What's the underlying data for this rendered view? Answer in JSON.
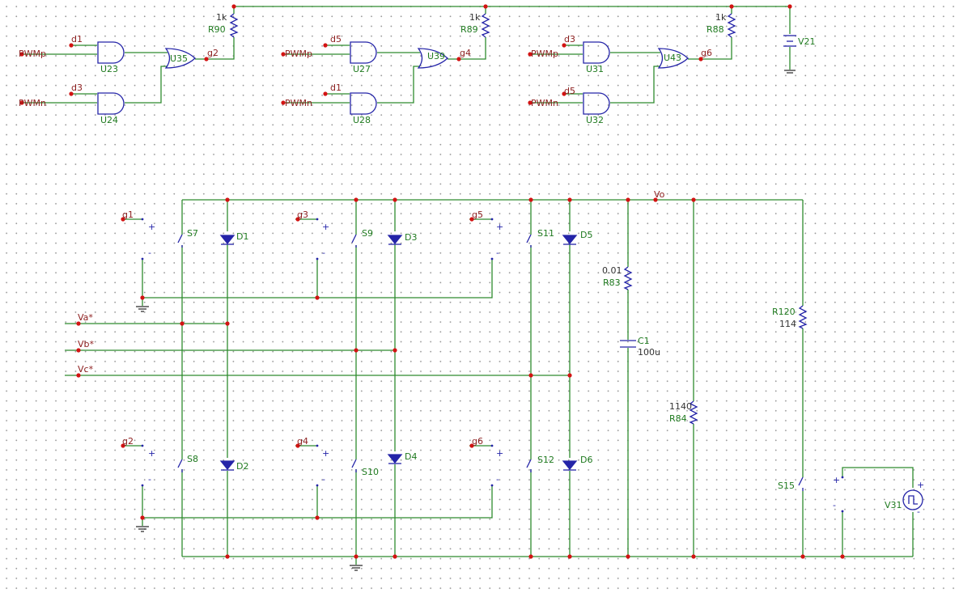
{
  "labels": {
    "pwmp": "PWMp",
    "pwmn": "PWMn",
    "d1": "d1",
    "d3": "d3",
    "d5": "d5",
    "g1": "g1",
    "g2": "g2",
    "g3": "g3",
    "g4": "g4",
    "g5": "g5",
    "g6": "g6",
    "va": "Va*",
    "vb": "Vb*",
    "vc": "Vc*",
    "vo": "Vo"
  },
  "gates": {
    "u23": "U23",
    "u24": "U24",
    "u35": "U35",
    "u27": "U27",
    "u28": "U28",
    "u39": "U39",
    "u31": "U31",
    "u32": "U32",
    "u43": "U43"
  },
  "resistors": {
    "r90": {
      "name": "R90",
      "value": "1k"
    },
    "r89": {
      "name": "R89",
      "value": "1k"
    },
    "r88": {
      "name": "R88",
      "value": "1k"
    },
    "r83": {
      "name": "R83",
      "value": "0.01"
    },
    "r84": {
      "name": "R84",
      "value": "1140"
    },
    "r120": {
      "name": "R120",
      "value": "114"
    }
  },
  "capacitor": {
    "name": "C1",
    "value": "100u"
  },
  "sources": {
    "v21": "V21",
    "v31": "V31"
  },
  "switches": {
    "s7": "S7",
    "s8": "S8",
    "s9": "S9",
    "s10": "S10",
    "s11": "S11",
    "s12": "S12",
    "s15": "S15"
  },
  "diodes": {
    "d1": "D1",
    "d2": "D2",
    "d3": "D3",
    "d4": "D4",
    "d5": "D5",
    "d6": "D6"
  },
  "signs": {
    "plus": "+",
    "minus": "-"
  },
  "colors": {
    "wire": "#2e8b2e",
    "junction": "#d31313",
    "component": "#2424a8",
    "net_label": "#8b1c1c"
  }
}
